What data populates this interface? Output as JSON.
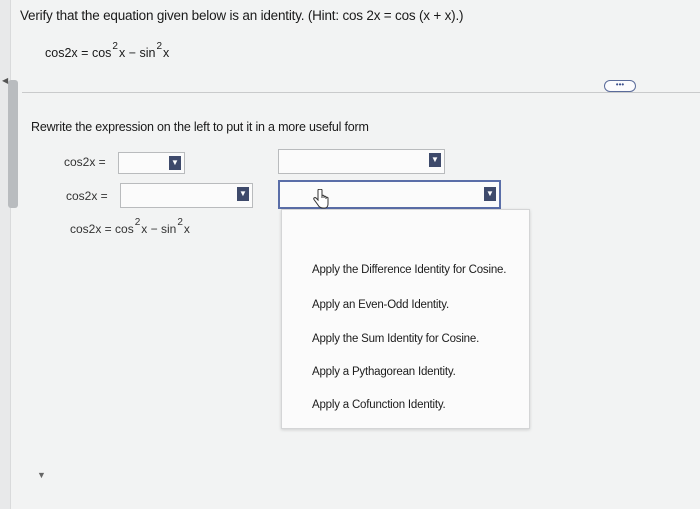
{
  "question": {
    "text": "Verify that the equation given below is an identity. (Hint: cos 2x = cos (x + x).)"
  },
  "equation": {
    "lhs": "cos2x",
    "eq": "=",
    "t1": "cos",
    "exp1": "2",
    "v1": "x",
    "minus": "−",
    "t2": "sin",
    "exp2": "2",
    "v2": "x"
  },
  "more_button": {
    "label": "•••"
  },
  "instruction": "Rewrite the expression on the left to put it in a more useful form",
  "rows": [
    {
      "label": "cos2x ="
    },
    {
      "label": "cos2x ="
    },
    {
      "label": "cos2x =",
      "t1": "cos",
      "exp1": "2",
      "v1": "x",
      "minus": "−",
      "t2": "sin",
      "exp2": "2",
      "v2": "x"
    }
  ],
  "dropdown_options": [
    "Apply the Difference Identity for Cosine.",
    "Apply an Even-Odd Identity.",
    "Apply the Sum Identity for Cosine.",
    "Apply a Pythagorean Identity.",
    "Apply a Cofunction Identity."
  ],
  "icons": {
    "select_arrow": "triangle-down-icon",
    "cursor": "hand-pointer-icon"
  },
  "colors": {
    "focus_border": "#5a6ea8",
    "arrow_bg": "#3e4a6b",
    "link_blue": "#3b4f8c"
  }
}
